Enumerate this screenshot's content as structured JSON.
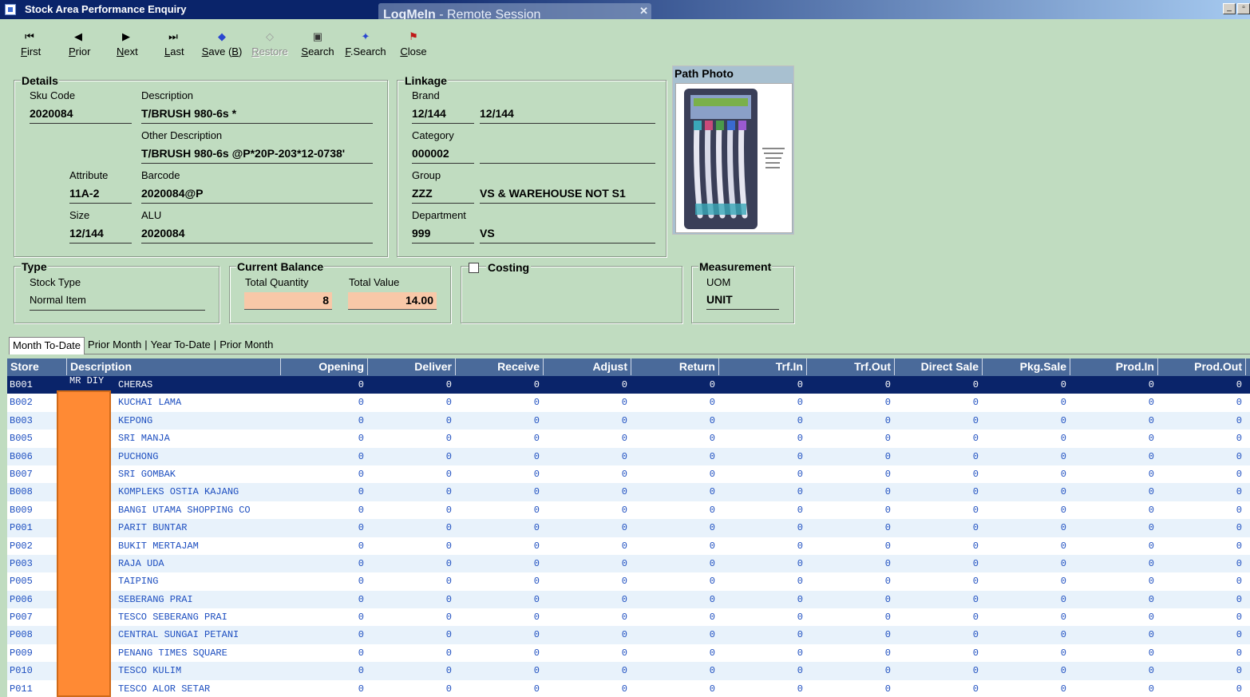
{
  "window": {
    "title": "Stock Area Performance Enquiry",
    "overlay_title_bold": "LogMeIn",
    "overlay_title_rest": " -  Remote Session"
  },
  "toolbar": [
    {
      "label": "First",
      "icon": "first-icon",
      "glyph": "⏮",
      "disabled": false
    },
    {
      "label": "Prior",
      "icon": "prior-icon",
      "glyph": "◀",
      "disabled": false
    },
    {
      "label": "Next",
      "icon": "next-icon",
      "glyph": "▶",
      "disabled": false
    },
    {
      "label": "Last",
      "icon": "last-icon",
      "glyph": "⏭",
      "disabled": false
    },
    {
      "label": "Save (B)",
      "icon": "save-icon",
      "glyph": "◆",
      "disabled": false
    },
    {
      "label": "Restore",
      "icon": "restore-icon",
      "glyph": "◇",
      "disabled": true
    },
    {
      "label": "Search",
      "icon": "search-icon",
      "glyph": "▣",
      "disabled": false
    },
    {
      "label": "F.Search",
      "icon": "fsearch-icon",
      "glyph": "✦",
      "disabled": false
    },
    {
      "label": "Close",
      "icon": "close-icon",
      "glyph": "⚑",
      "disabled": false
    }
  ],
  "details": {
    "title": "Details",
    "sku_code_label": "Sku Code",
    "sku_code": "2020084",
    "description_label": "Description",
    "description": "T/BRUSH 980-6s *",
    "other_description_label": "Other Description",
    "other_description": "T/BRUSH 980-6s @P*20P-203*12-0738'",
    "attribute_label": "Attribute",
    "attribute": "11A-2",
    "barcode_label": "Barcode",
    "barcode": "2020084@P",
    "size_label": "Size",
    "size": "12/144",
    "alu_label": "ALU",
    "alu": "2020084"
  },
  "linkage": {
    "title": "Linkage",
    "brand_label": "Brand",
    "brand_code": "12/144",
    "brand_name": "12/144",
    "category_label": "Category",
    "category_code": "000002",
    "category_name": "",
    "group_label": "Group",
    "group_code": "ZZZ",
    "group_name": "VS & WAREHOUSE NOT S1",
    "department_label": "Department",
    "department_code": "999",
    "department_name": "VS"
  },
  "photo": {
    "title": "Path Photo"
  },
  "type": {
    "title": "Type",
    "stock_type_label": "Stock Type",
    "stock_type": "Normal Item"
  },
  "balance": {
    "title": "Current Balance",
    "total_quantity_label": "Total Quantity",
    "total_quantity": "8",
    "total_value_label": "Total Value",
    "total_value": "14.00"
  },
  "costing": {
    "title": "Costing",
    "checked": false
  },
  "measurement": {
    "title": "Measurement",
    "uom_label": "UOM",
    "uom": "UNIT"
  },
  "tabs": [
    "Month To-Date",
    "Prior Month",
    "Year To-Date",
    "Prior Month"
  ],
  "grid": {
    "columns": [
      "Store",
      "Description",
      "Opening",
      "Deliver",
      "Receive",
      "Adjust",
      "Return",
      "Trf.In",
      "Trf.Out",
      "Direct Sale",
      "Pkg.Sale",
      "Prod.In",
      "Prod.Out"
    ],
    "rows": [
      {
        "store": "B001",
        "prefix": "MR DIY",
        "description": "CHERAS",
        "values": [
          "0",
          "0",
          "0",
          "0",
          "0",
          "0",
          "0",
          "0",
          "0",
          "0",
          "0"
        ]
      },
      {
        "store": "B002",
        "prefix": "",
        "description": "KUCHAI LAMA",
        "values": [
          "0",
          "0",
          "0",
          "0",
          "0",
          "0",
          "0",
          "0",
          "0",
          "0",
          "0"
        ]
      },
      {
        "store": "B003",
        "prefix": "",
        "description": "KEPONG",
        "values": [
          "0",
          "0",
          "0",
          "0",
          "0",
          "0",
          "0",
          "0",
          "0",
          "0",
          "0"
        ]
      },
      {
        "store": "B005",
        "prefix": "",
        "description": "SRI MANJA",
        "values": [
          "0",
          "0",
          "0",
          "0",
          "0",
          "0",
          "0",
          "0",
          "0",
          "0",
          "0"
        ]
      },
      {
        "store": "B006",
        "prefix": "",
        "description": "PUCHONG",
        "values": [
          "0",
          "0",
          "0",
          "0",
          "0",
          "0",
          "0",
          "0",
          "0",
          "0",
          "0"
        ]
      },
      {
        "store": "B007",
        "prefix": "",
        "description": "SRI GOMBAK",
        "values": [
          "0",
          "0",
          "0",
          "0",
          "0",
          "0",
          "0",
          "0",
          "0",
          "0",
          "0"
        ]
      },
      {
        "store": "B008",
        "prefix": "",
        "description": "KOMPLEKS OSTIA KAJANG",
        "values": [
          "0",
          "0",
          "0",
          "0",
          "0",
          "0",
          "0",
          "0",
          "0",
          "0",
          "0"
        ]
      },
      {
        "store": "B009",
        "prefix": "",
        "description": "BANGI UTAMA SHOPPING CO",
        "values": [
          "0",
          "0",
          "0",
          "0",
          "0",
          "0",
          "0",
          "0",
          "0",
          "0",
          "0"
        ]
      },
      {
        "store": "P001",
        "prefix": "",
        "description": "PARIT BUNTAR",
        "values": [
          "0",
          "0",
          "0",
          "0",
          "0",
          "0",
          "0",
          "0",
          "0",
          "0",
          "0"
        ]
      },
      {
        "store": "P002",
        "prefix": "",
        "description": "BUKIT MERTAJAM",
        "values": [
          "0",
          "0",
          "0",
          "0",
          "0",
          "0",
          "0",
          "0",
          "0",
          "0",
          "0"
        ]
      },
      {
        "store": "P003",
        "prefix": "",
        "description": "RAJA UDA",
        "values": [
          "0",
          "0",
          "0",
          "0",
          "0",
          "0",
          "0",
          "0",
          "0",
          "0",
          "0"
        ]
      },
      {
        "store": "P005",
        "prefix": "",
        "description": "TAIPING",
        "values": [
          "0",
          "0",
          "0",
          "0",
          "0",
          "0",
          "0",
          "0",
          "0",
          "0",
          "0"
        ]
      },
      {
        "store": "P006",
        "prefix": "",
        "description": "SEBERANG PRAI",
        "values": [
          "0",
          "0",
          "0",
          "0",
          "0",
          "0",
          "0",
          "0",
          "0",
          "0",
          "0"
        ]
      },
      {
        "store": "P007",
        "prefix": "",
        "description": "TESCO SEBERANG PRAI",
        "values": [
          "0",
          "0",
          "0",
          "0",
          "0",
          "0",
          "0",
          "0",
          "0",
          "0",
          "0"
        ]
      },
      {
        "store": "P008",
        "prefix": "",
        "description": "CENTRAL SUNGAI PETANI",
        "values": [
          "0",
          "0",
          "0",
          "0",
          "0",
          "0",
          "0",
          "0",
          "0",
          "0",
          "0"
        ]
      },
      {
        "store": "P009",
        "prefix": "",
        "description": "PENANG TIMES SQUARE",
        "values": [
          "0",
          "0",
          "0",
          "0",
          "0",
          "0",
          "0",
          "0",
          "0",
          "0",
          "0"
        ]
      },
      {
        "store": "P010",
        "prefix": "",
        "description": "TESCO KULIM",
        "values": [
          "0",
          "0",
          "0",
          "0",
          "0",
          "0",
          "0",
          "0",
          "0",
          "0",
          "0"
        ]
      },
      {
        "store": "P011",
        "prefix": "",
        "description": "TESCO ALOR SETAR",
        "values": [
          "0",
          "0",
          "0",
          "0",
          "0",
          "0",
          "0",
          "0",
          "0",
          "0",
          "0"
        ]
      }
    ]
  }
}
